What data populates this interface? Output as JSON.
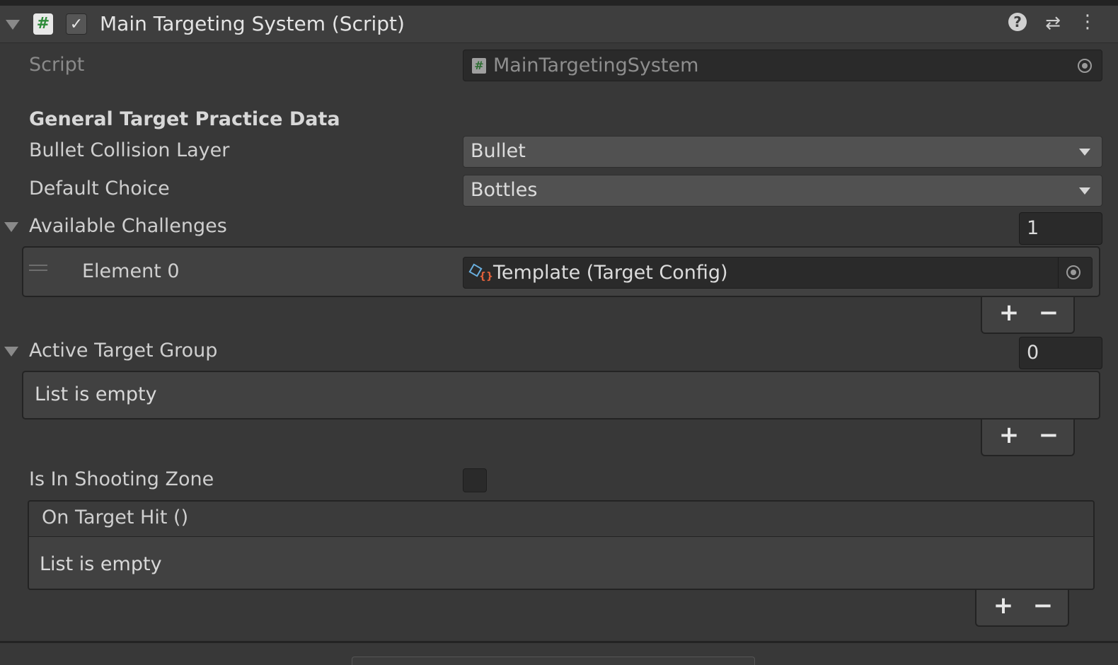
{
  "component": {
    "title": "Main Targeting System (Script)",
    "script_label": "Script",
    "script_value": "MainTargetingSystem"
  },
  "section": {
    "title": "General Target Practice Data"
  },
  "fields": {
    "bullet_collision_layer_label": "Bullet Collision Layer",
    "bullet_collision_layer_value": "Bullet",
    "default_choice_label": "Default Choice",
    "default_choice_value": "Bottles"
  },
  "available_challenges": {
    "label": "Available Challenges",
    "size": "1",
    "elements": [
      {
        "label": "Element 0",
        "value": "Template (Target Config)"
      }
    ]
  },
  "active_target_group": {
    "label": "Active Target Group",
    "size": "0",
    "empty_text": "List is empty"
  },
  "is_in_shooting_zone": {
    "label": "Is In Shooting Zone",
    "checked": false
  },
  "on_target_hit": {
    "label": "On Target Hit ()",
    "empty_text": "List is empty"
  },
  "buttons": {
    "plus": "+",
    "minus": "−"
  },
  "icons": {
    "script": "#",
    "check": "✓",
    "help": "?",
    "presets": "⇄",
    "menu": "⋮"
  },
  "colors": {
    "background": "#383838",
    "header": "#3e3e3e",
    "field": "#2a2a2a",
    "dropdown": "#515151",
    "script_icon_green": "#2e8b3a"
  }
}
